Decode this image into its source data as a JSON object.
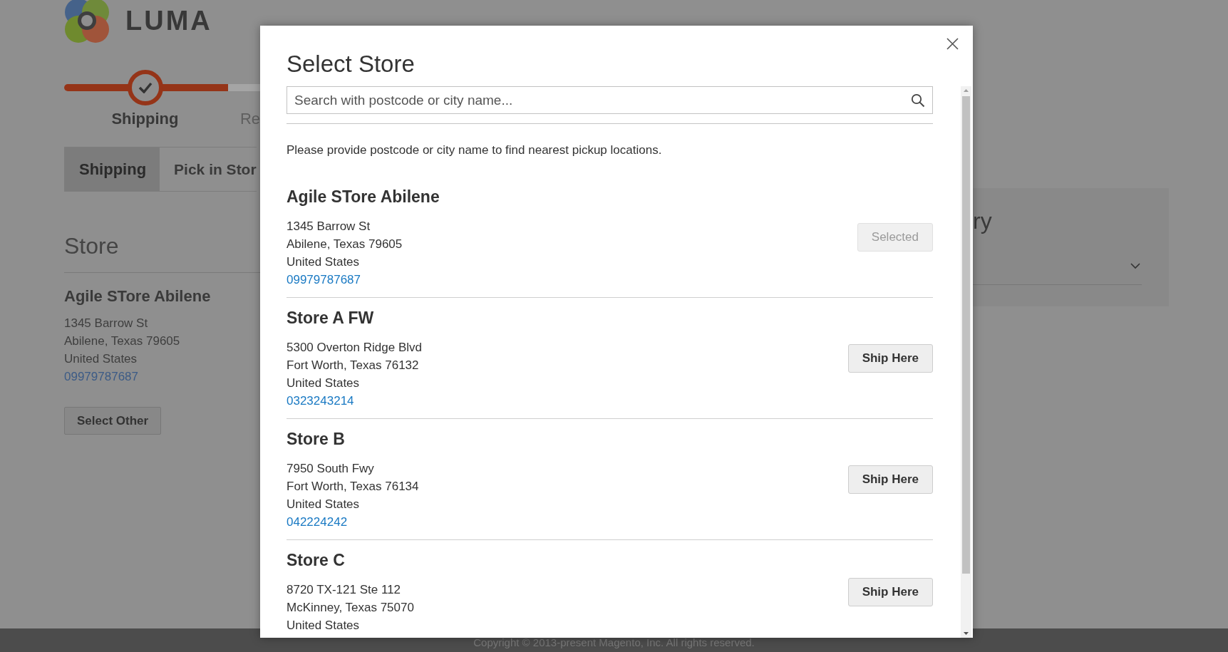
{
  "header": {
    "logo_text": "LUMA"
  },
  "progress": {
    "steps": [
      {
        "label": "Shipping",
        "selected": true
      },
      {
        "label": "Re",
        "selected": false
      }
    ]
  },
  "tabs": [
    {
      "label": "Shipping",
      "selected": true
    },
    {
      "label": "Pick in Stor",
      "selected": false
    }
  ],
  "store_section": {
    "title": "Store",
    "store": {
      "name": "Agile STore Abilene",
      "address_lines": [
        "1345 Barrow St",
        "Abilene, Texas 79605",
        "United States"
      ],
      "phone": "09979787687"
    },
    "button": "Select Other"
  },
  "summary_panel": {
    "title": "ry"
  },
  "modal": {
    "title": "Select Store",
    "search": {
      "placeholder": "Search with postcode or city name..."
    },
    "message": "Please provide postcode or city name to find nearest pickup locations.",
    "stores": [
      {
        "name": "Agile STore Abilene",
        "address_lines": [
          "1345 Barrow St",
          "Abilene, Texas 79605",
          "United States"
        ],
        "phone": "09979787687",
        "button": "Selected",
        "selected": true
      },
      {
        "name": "Store A FW",
        "address_lines": [
          "5300 Overton Ridge Blvd",
          "Fort Worth, Texas 76132",
          "United States"
        ],
        "phone": "0323243214",
        "button": "Ship Here",
        "selected": false
      },
      {
        "name": "Store B",
        "address_lines": [
          "7950 South Fwy",
          "Fort Worth, Texas 76134",
          "United States"
        ],
        "phone": "042224242",
        "button": "Ship Here",
        "selected": false
      },
      {
        "name": "Store C",
        "address_lines": [
          "8720 TX-121 Ste 112",
          "McKinney, Texas 75070",
          "United States"
        ],
        "button": "Ship Here",
        "selected": false
      }
    ]
  },
  "footer": {
    "copyright": "Copyright © 2013-present Magento, Inc. All rights reserved."
  }
}
